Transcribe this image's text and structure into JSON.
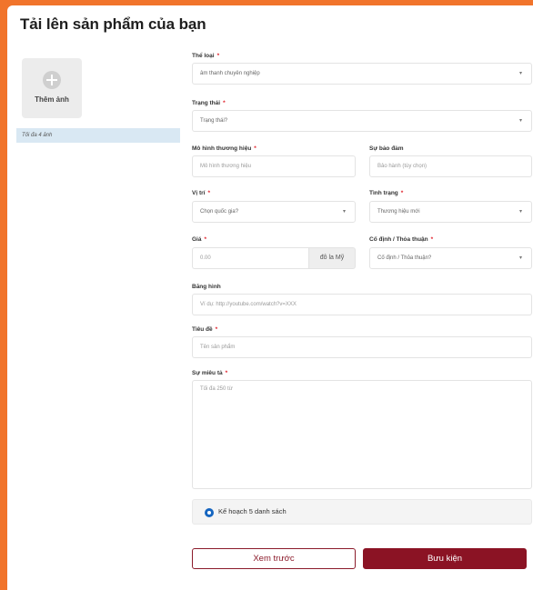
{
  "page": {
    "title": "Tải lên sản phẩm của bạn"
  },
  "photos": {
    "add_label": "Thêm ảnh",
    "limit_text": "Tối đa 4 ảnh"
  },
  "form": {
    "required_mark": "*",
    "category": {
      "label": "Thể loại",
      "value": "âm thanh chuyên nghiệp"
    },
    "status": {
      "label": "Trạng thái",
      "value": "Trạng thái?"
    },
    "brand_model": {
      "label": "Mô hình thương hiệu",
      "placeholder": "Mô hình thương hiệu"
    },
    "warranty": {
      "label": "Sự bảo đảm",
      "placeholder": "Bảo hành (tùy chọn)"
    },
    "location": {
      "label": "Vị trí",
      "value": "Chọn quốc gia?"
    },
    "condition": {
      "label": "Tình trạng",
      "value": "Thương hiệu mới"
    },
    "price": {
      "label": "Giá",
      "placeholder": "0.00",
      "unit": "đô la Mỹ"
    },
    "fixed_negotiable": {
      "label": "Cố định / Thỏa thuận",
      "value": "Cố định / Thỏa thuận?"
    },
    "video": {
      "label": "Băng hình",
      "placeholder": "Ví dụ: http://youtube.com/watch?v=XXX"
    },
    "title": {
      "label": "Tiêu đề",
      "placeholder": "Tên sản phẩm"
    },
    "description": {
      "label": "Sự miêu tả",
      "placeholder": "Tối đa 250 từ"
    },
    "plan": {
      "label": "Kế hoạch 5 danh sách"
    },
    "preview_button": "Xem trước",
    "submit_button": "Bưu kiện"
  },
  "colors": {
    "background": "#f1742b",
    "accent": "#8b1324",
    "radio": "#1565c0",
    "required": "#e0202a"
  },
  "icons": {
    "add_photo": "plus-circle-icon",
    "dropdown": "chevron-down-icon",
    "plan_selected": "radio-selected-icon"
  }
}
